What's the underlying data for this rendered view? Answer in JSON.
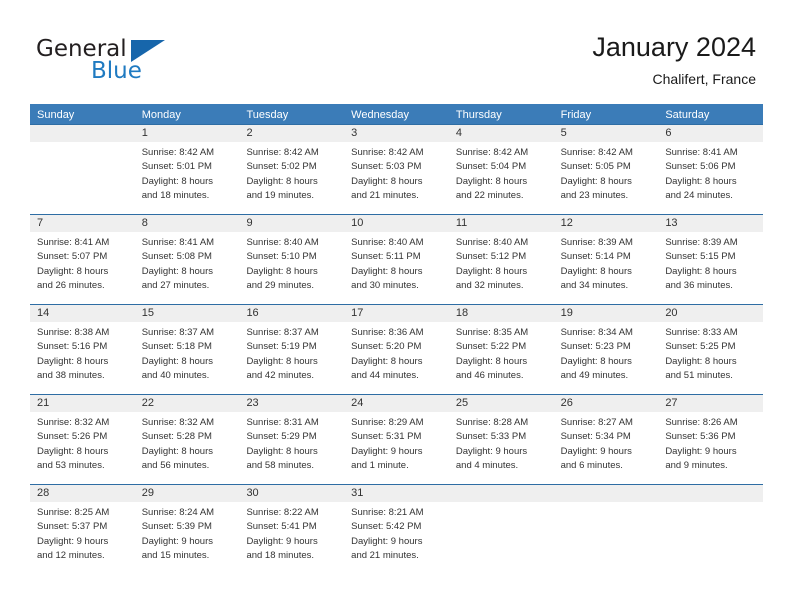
{
  "brand": {
    "name_top": "General",
    "name_bottom": "Blue",
    "accent_color": "#1f7ac1",
    "triangle_color": "#1766ab"
  },
  "header": {
    "title": "January 2024",
    "subtitle": "Chalifert, France"
  },
  "calendar": {
    "header_bg": "#3b7cb8",
    "daynum_bg": "#efefef",
    "separator_color": "#2e6da4",
    "weekdays": [
      "Sunday",
      "Monday",
      "Tuesday",
      "Wednesday",
      "Thursday",
      "Friday",
      "Saturday"
    ],
    "weeks": [
      {
        "numbers": [
          "",
          "1",
          "2",
          "3",
          "4",
          "5",
          "6"
        ],
        "days": [
          {
            "sunrise": "",
            "sunset": "",
            "daylight_1": "",
            "daylight_2": ""
          },
          {
            "sunrise": "Sunrise: 8:42 AM",
            "sunset": "Sunset: 5:01 PM",
            "daylight_1": "Daylight: 8 hours",
            "daylight_2": "and 18 minutes."
          },
          {
            "sunrise": "Sunrise: 8:42 AM",
            "sunset": "Sunset: 5:02 PM",
            "daylight_1": "Daylight: 8 hours",
            "daylight_2": "and 19 minutes."
          },
          {
            "sunrise": "Sunrise: 8:42 AM",
            "sunset": "Sunset: 5:03 PM",
            "daylight_1": "Daylight: 8 hours",
            "daylight_2": "and 21 minutes."
          },
          {
            "sunrise": "Sunrise: 8:42 AM",
            "sunset": "Sunset: 5:04 PM",
            "daylight_1": "Daylight: 8 hours",
            "daylight_2": "and 22 minutes."
          },
          {
            "sunrise": "Sunrise: 8:42 AM",
            "sunset": "Sunset: 5:05 PM",
            "daylight_1": "Daylight: 8 hours",
            "daylight_2": "and 23 minutes."
          },
          {
            "sunrise": "Sunrise: 8:41 AM",
            "sunset": "Sunset: 5:06 PM",
            "daylight_1": "Daylight: 8 hours",
            "daylight_2": "and 24 minutes."
          }
        ]
      },
      {
        "numbers": [
          "7",
          "8",
          "9",
          "10",
          "11",
          "12",
          "13"
        ],
        "days": [
          {
            "sunrise": "Sunrise: 8:41 AM",
            "sunset": "Sunset: 5:07 PM",
            "daylight_1": "Daylight: 8 hours",
            "daylight_2": "and 26 minutes."
          },
          {
            "sunrise": "Sunrise: 8:41 AM",
            "sunset": "Sunset: 5:08 PM",
            "daylight_1": "Daylight: 8 hours",
            "daylight_2": "and 27 minutes."
          },
          {
            "sunrise": "Sunrise: 8:40 AM",
            "sunset": "Sunset: 5:10 PM",
            "daylight_1": "Daylight: 8 hours",
            "daylight_2": "and 29 minutes."
          },
          {
            "sunrise": "Sunrise: 8:40 AM",
            "sunset": "Sunset: 5:11 PM",
            "daylight_1": "Daylight: 8 hours",
            "daylight_2": "and 30 minutes."
          },
          {
            "sunrise": "Sunrise: 8:40 AM",
            "sunset": "Sunset: 5:12 PM",
            "daylight_1": "Daylight: 8 hours",
            "daylight_2": "and 32 minutes."
          },
          {
            "sunrise": "Sunrise: 8:39 AM",
            "sunset": "Sunset: 5:14 PM",
            "daylight_1": "Daylight: 8 hours",
            "daylight_2": "and 34 minutes."
          },
          {
            "sunrise": "Sunrise: 8:39 AM",
            "sunset": "Sunset: 5:15 PM",
            "daylight_1": "Daylight: 8 hours",
            "daylight_2": "and 36 minutes."
          }
        ]
      },
      {
        "numbers": [
          "14",
          "15",
          "16",
          "17",
          "18",
          "19",
          "20"
        ],
        "days": [
          {
            "sunrise": "Sunrise: 8:38 AM",
            "sunset": "Sunset: 5:16 PM",
            "daylight_1": "Daylight: 8 hours",
            "daylight_2": "and 38 minutes."
          },
          {
            "sunrise": "Sunrise: 8:37 AM",
            "sunset": "Sunset: 5:18 PM",
            "daylight_1": "Daylight: 8 hours",
            "daylight_2": "and 40 minutes."
          },
          {
            "sunrise": "Sunrise: 8:37 AM",
            "sunset": "Sunset: 5:19 PM",
            "daylight_1": "Daylight: 8 hours",
            "daylight_2": "and 42 minutes."
          },
          {
            "sunrise": "Sunrise: 8:36 AM",
            "sunset": "Sunset: 5:20 PM",
            "daylight_1": "Daylight: 8 hours",
            "daylight_2": "and 44 minutes."
          },
          {
            "sunrise": "Sunrise: 8:35 AM",
            "sunset": "Sunset: 5:22 PM",
            "daylight_1": "Daylight: 8 hours",
            "daylight_2": "and 46 minutes."
          },
          {
            "sunrise": "Sunrise: 8:34 AM",
            "sunset": "Sunset: 5:23 PM",
            "daylight_1": "Daylight: 8 hours",
            "daylight_2": "and 49 minutes."
          },
          {
            "sunrise": "Sunrise: 8:33 AM",
            "sunset": "Sunset: 5:25 PM",
            "daylight_1": "Daylight: 8 hours",
            "daylight_2": "and 51 minutes."
          }
        ]
      },
      {
        "numbers": [
          "21",
          "22",
          "23",
          "24",
          "25",
          "26",
          "27"
        ],
        "days": [
          {
            "sunrise": "Sunrise: 8:32 AM",
            "sunset": "Sunset: 5:26 PM",
            "daylight_1": "Daylight: 8 hours",
            "daylight_2": "and 53 minutes."
          },
          {
            "sunrise": "Sunrise: 8:32 AM",
            "sunset": "Sunset: 5:28 PM",
            "daylight_1": "Daylight: 8 hours",
            "daylight_2": "and 56 minutes."
          },
          {
            "sunrise": "Sunrise: 8:31 AM",
            "sunset": "Sunset: 5:29 PM",
            "daylight_1": "Daylight: 8 hours",
            "daylight_2": "and 58 minutes."
          },
          {
            "sunrise": "Sunrise: 8:29 AM",
            "sunset": "Sunset: 5:31 PM",
            "daylight_1": "Daylight: 9 hours",
            "daylight_2": "and 1 minute."
          },
          {
            "sunrise": "Sunrise: 8:28 AM",
            "sunset": "Sunset: 5:33 PM",
            "daylight_1": "Daylight: 9 hours",
            "daylight_2": "and 4 minutes."
          },
          {
            "sunrise": "Sunrise: 8:27 AM",
            "sunset": "Sunset: 5:34 PM",
            "daylight_1": "Daylight: 9 hours",
            "daylight_2": "and 6 minutes."
          },
          {
            "sunrise": "Sunrise: 8:26 AM",
            "sunset": "Sunset: 5:36 PM",
            "daylight_1": "Daylight: 9 hours",
            "daylight_2": "and 9 minutes."
          }
        ]
      },
      {
        "numbers": [
          "28",
          "29",
          "30",
          "31",
          "",
          "",
          ""
        ],
        "days": [
          {
            "sunrise": "Sunrise: 8:25 AM",
            "sunset": "Sunset: 5:37 PM",
            "daylight_1": "Daylight: 9 hours",
            "daylight_2": "and 12 minutes."
          },
          {
            "sunrise": "Sunrise: 8:24 AM",
            "sunset": "Sunset: 5:39 PM",
            "daylight_1": "Daylight: 9 hours",
            "daylight_2": "and 15 minutes."
          },
          {
            "sunrise": "Sunrise: 8:22 AM",
            "sunset": "Sunset: 5:41 PM",
            "daylight_1": "Daylight: 9 hours",
            "daylight_2": "and 18 minutes."
          },
          {
            "sunrise": "Sunrise: 8:21 AM",
            "sunset": "Sunset: 5:42 PM",
            "daylight_1": "Daylight: 9 hours",
            "daylight_2": "and 21 minutes."
          },
          {
            "sunrise": "",
            "sunset": "",
            "daylight_1": "",
            "daylight_2": ""
          },
          {
            "sunrise": "",
            "sunset": "",
            "daylight_1": "",
            "daylight_2": ""
          },
          {
            "sunrise": "",
            "sunset": "",
            "daylight_1": "",
            "daylight_2": ""
          }
        ]
      }
    ]
  }
}
